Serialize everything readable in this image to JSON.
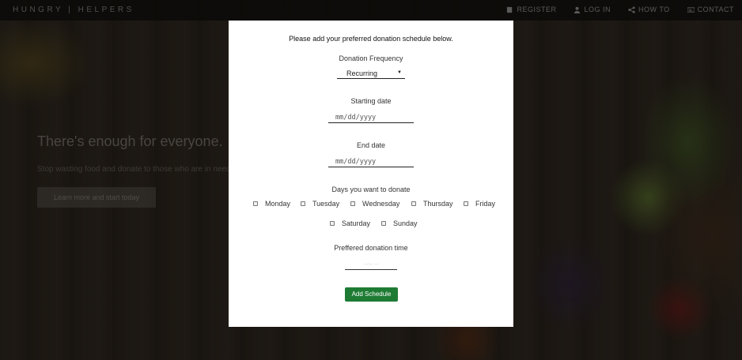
{
  "nav": {
    "brand": "HUNGRY | HELPERS",
    "links": [
      {
        "label": "REGISTER",
        "icon": "book-icon"
      },
      {
        "label": "LOG IN",
        "icon": "user-icon"
      },
      {
        "label": "HOW TO",
        "icon": "share-icon"
      },
      {
        "label": "CONTACT",
        "icon": "card-icon"
      }
    ]
  },
  "hero": {
    "title": "There's enough for everyone.",
    "subtitle": "Stop wasting food and donate to those who are in need.",
    "button": "Learn more and start today"
  },
  "modal": {
    "heading": "Please add your preferred donation schedule below.",
    "frequency_label": "Donation Frequency",
    "frequency_value": "Recurring",
    "start_label": "Starting date",
    "start_placeholder": "mm/dd/yyyy",
    "end_label": "End date",
    "end_placeholder": "mm/dd/yyyy",
    "days_label": "Days you want to donate",
    "days": [
      "Monday",
      "Tuesday",
      "Wednesday",
      "Thursday",
      "Friday",
      "Saturday",
      "Sunday"
    ],
    "time_label": "Preffered donation time",
    "time_placeholder": "--:-- --",
    "submit": "Add Schedule"
  },
  "colors": {
    "accent": "#1e7b34",
    "modal_bg": "#ffffff"
  }
}
